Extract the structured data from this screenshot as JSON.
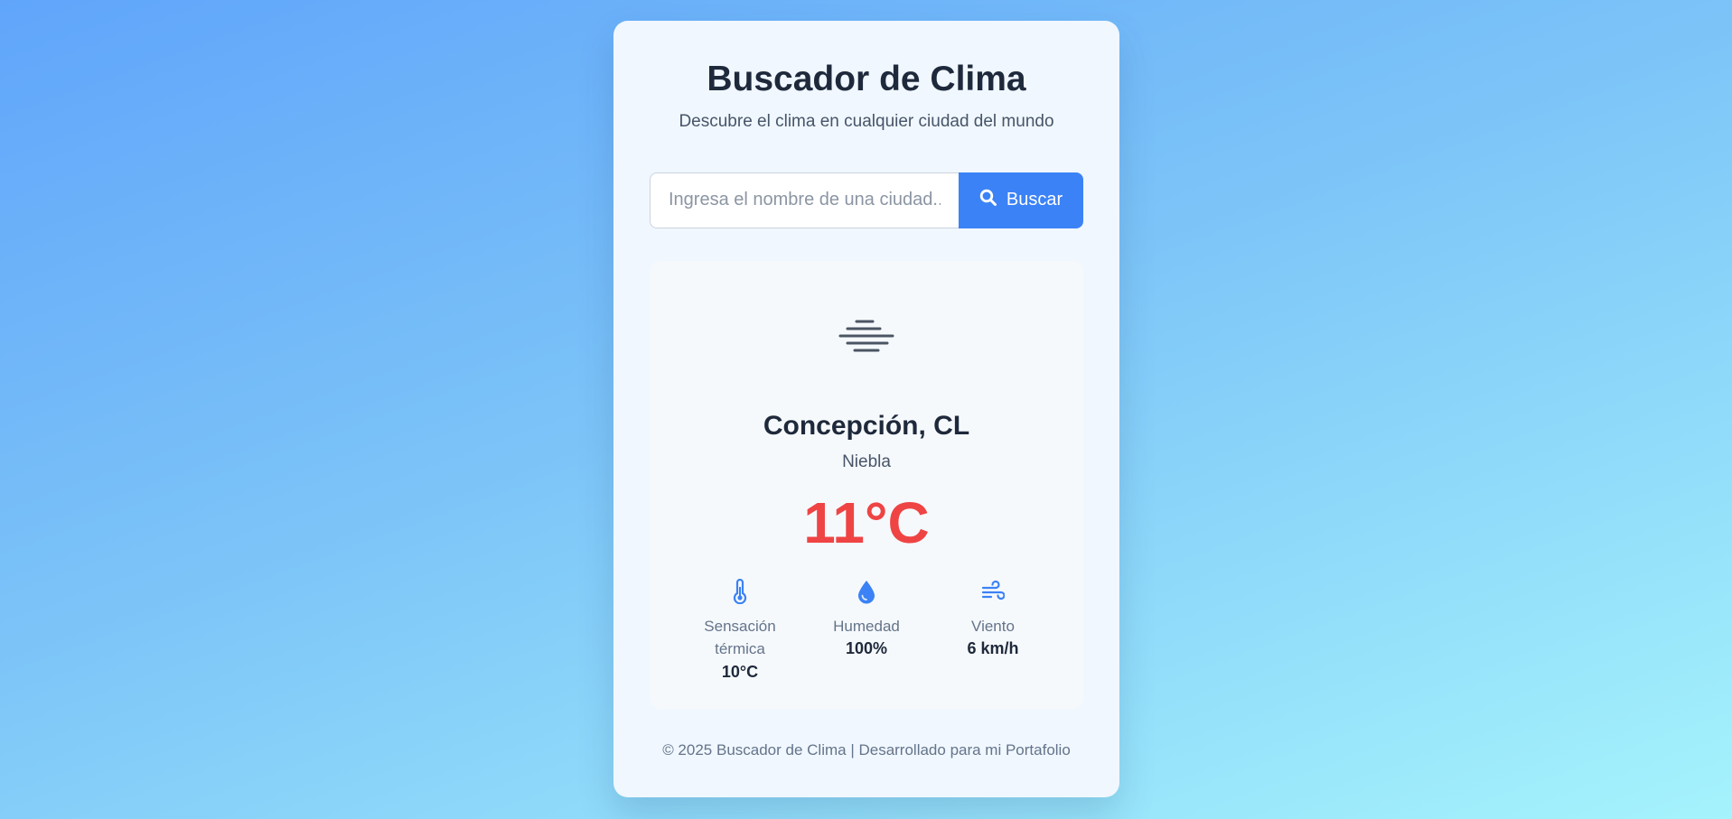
{
  "header": {
    "title": "Buscador de Clima",
    "subtitle": "Descubre el clima en cualquier ciudad del mundo"
  },
  "search": {
    "placeholder": "Ingresa el nombre de una ciudad...",
    "value": "",
    "button_label": "Buscar",
    "button_icon": "search-icon"
  },
  "weather": {
    "condition_icon": "fog-icon",
    "city": "Concepción, CL",
    "description": "Niebla",
    "temperature": "11°C",
    "details": [
      {
        "icon": "thermometer-icon",
        "label": "Sensación térmica",
        "value": "10°C"
      },
      {
        "icon": "droplet-icon",
        "label": "Humedad",
        "value": "100%"
      },
      {
        "icon": "wind-icon",
        "label": "Viento",
        "value": "6 km/h"
      }
    ]
  },
  "footer": {
    "text": "© 2025 Buscador de Clima | Desarrollado para mi Portafolio"
  },
  "colors": {
    "accent": "#3b82f6",
    "temperature": "#ef4444",
    "title": "#1e293b"
  }
}
